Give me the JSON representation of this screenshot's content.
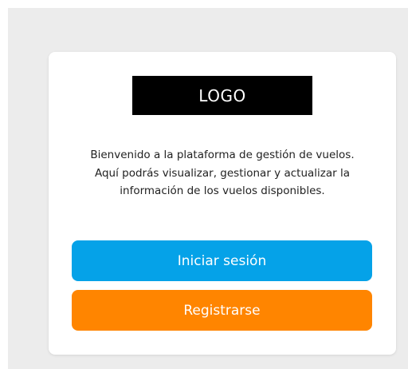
{
  "logo": {
    "text": "LOGO"
  },
  "welcome": {
    "message": "Bienvenido a la plataforma de gestión de vuelos. Aquí podrás visualizar, gestionar y actualizar la información de los vuelos disponibles."
  },
  "actions": {
    "login_label": "Iniciar sesión",
    "register_label": "Registrarse"
  },
  "colors": {
    "login_button": "#05a2e8",
    "register_button": "#ff8500",
    "logo_background": "#000000",
    "page_background": "#ececec"
  }
}
